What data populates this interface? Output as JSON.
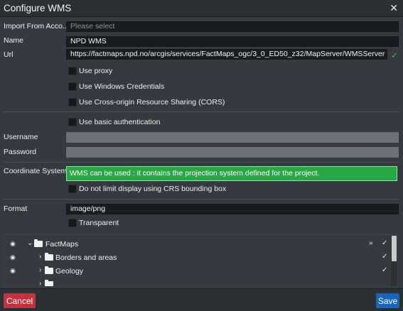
{
  "window": {
    "title": "Configure WMS",
    "close_icon": "close-icon"
  },
  "form": {
    "import_label": "Import From Acco...",
    "import_placeholder": "Please select",
    "name_label": "Name",
    "name_value": "NPD WMS",
    "url_label": "Url",
    "url_value": "https://factmaps.npd.no/arcgis/services/FactMaps_ogc/3_0_ED50_z32/MapServer/WMSServer",
    "use_proxy": "Use proxy",
    "use_windows_credentials": "Use Windows Credentials",
    "use_cors": "Use Cross-origin Resource Sharing (CORS)",
    "use_basic_auth": "Use basic authentication",
    "username_label": "Username",
    "password_label": "Password",
    "crs_label": "Coordinate System",
    "crs_message": "WMS can be used : it contains the projection system defined for the project.",
    "no_limit_crs": "Do not limit display using CRS bounding box",
    "format_label": "Format",
    "format_value": "image/png",
    "transparent": "Transparent"
  },
  "layers": [
    {
      "name": "FactMaps",
      "expanded": true
    },
    {
      "name": "Borders and areas",
      "expanded": false
    },
    {
      "name": "Geology",
      "expanded": false
    }
  ],
  "footer": {
    "cancel_label": "Cancel",
    "save_label": "Save"
  },
  "colors": {
    "cancel": "#c9303c",
    "save": "#1565c0",
    "success": "#28a745"
  }
}
